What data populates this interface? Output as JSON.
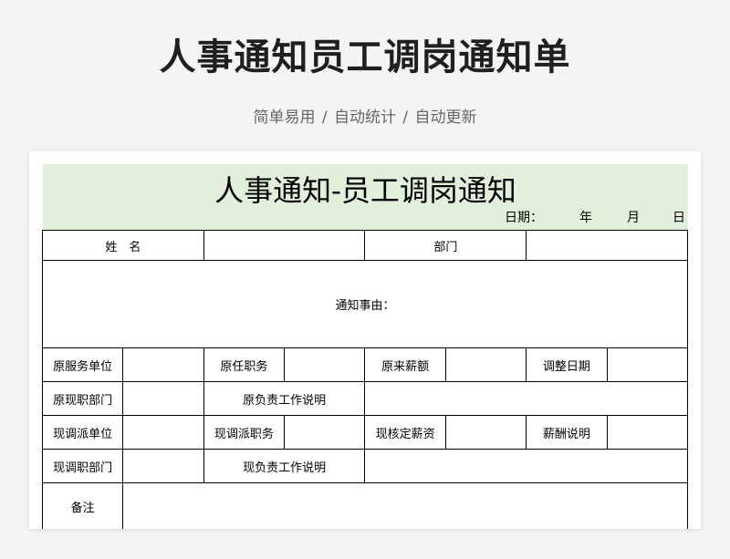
{
  "page": {
    "title": "人事通知员工调岗通知单",
    "subtitle": "简单易用 / 自动统计 / 自动更新"
  },
  "sheet": {
    "title": "人事通知-员工调岗通知",
    "date_label": "日期：",
    "year": "年",
    "month": "月",
    "day": "日"
  },
  "form": {
    "name_label": "姓　名",
    "dept_label": "部门",
    "reason_label": "通知事由：",
    "rows": [
      {
        "l1": "原服务单位",
        "l2": "原任职务",
        "l3": "原来薪额",
        "l4": "调整日期"
      },
      {
        "l1": "现调派单位",
        "l2": "现调派职务",
        "l3": "现核定薪资",
        "l4": "薪酬说明"
      }
    ],
    "orig_dept_label": "原现职部门",
    "orig_duty_label": "原负责工作说明",
    "new_dept_label": "现调职部门",
    "new_duty_label": "现负责工作说明",
    "remark_label": "备注"
  }
}
